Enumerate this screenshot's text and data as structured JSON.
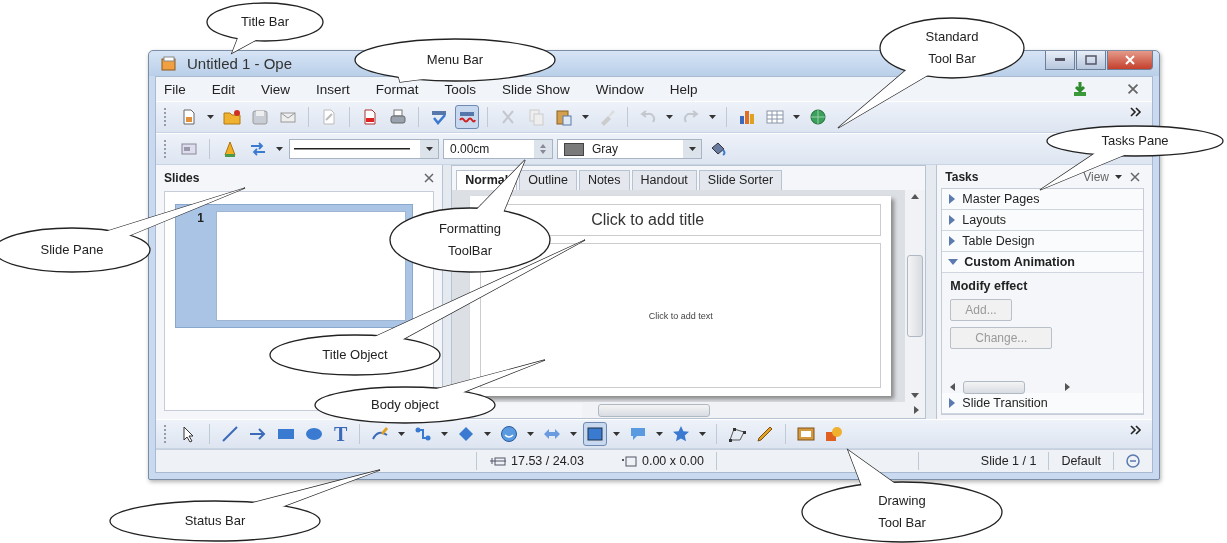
{
  "window": {
    "title": "Untitled 1 - Ope"
  },
  "menu": [
    "File",
    "Edit",
    "View",
    "Insert",
    "Format",
    "Tools",
    "Slide Show",
    "Window",
    "Help"
  ],
  "standard_toolbar": {
    "auto_spellcheck": true
  },
  "formatting_toolbar": {
    "line_width": "0.00cm",
    "area_color": "Gray"
  },
  "slides_pane": {
    "title": "Slides",
    "slides": [
      {
        "number": "1",
        "selected": true
      }
    ]
  },
  "view_tabs": [
    {
      "label": "Normal",
      "selected": true
    },
    {
      "label": "Outline",
      "selected": false
    },
    {
      "label": "Notes",
      "selected": false
    },
    {
      "label": "Handout",
      "selected": false
    },
    {
      "label": "Slide Sorter",
      "selected": false
    }
  ],
  "slide": {
    "title_placeholder": "Click to add title",
    "body_placeholder": "Click to add text"
  },
  "tasks_pane": {
    "title": "Tasks",
    "view_menu": "View",
    "sections": [
      {
        "label": "Master Pages",
        "expanded": false
      },
      {
        "label": "Layouts",
        "expanded": false
      },
      {
        "label": "Table Design",
        "expanded": false
      },
      {
        "label": "Custom Animation",
        "expanded": true
      },
      {
        "label": "Slide Transition",
        "expanded": false
      }
    ],
    "custom_animation": {
      "heading": "Modify effect",
      "buttons": [
        {
          "label": "Add...",
          "disabled": true
        },
        {
          "label": "Change...",
          "disabled": true
        }
      ]
    }
  },
  "drawing_toolbar": {
    "text_tool": "T"
  },
  "status_bar": {
    "position": "17.53 / 24.03",
    "size": "0.00 x 0.00",
    "slide": "Slide 1 / 1",
    "layout": "Default"
  },
  "callouts": [
    {
      "label": "Title Bar"
    },
    {
      "label": "Menu Bar"
    },
    {
      "label": "Standard\nTool Bar"
    },
    {
      "label": "Tasks Pane"
    },
    {
      "label": "Slide Pane"
    },
    {
      "label": "Formatting\nToolBar"
    },
    {
      "label": "Title Object"
    },
    {
      "label": "Body object"
    },
    {
      "label": "Status Bar"
    },
    {
      "label": "Drawing\nTool Bar"
    }
  ]
}
